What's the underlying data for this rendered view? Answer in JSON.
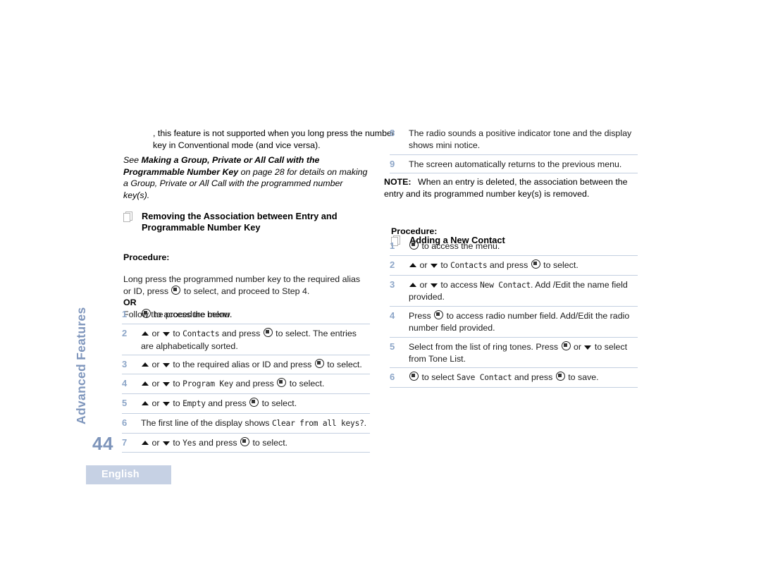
{
  "chapter": {
    "vertical_label": "Advanced Features",
    "page_number": "44",
    "language_tab": "English"
  },
  "left_column": {
    "intro_paragraph": ", this feature is not supported when you long press the number key in Conventional mode (and vice versa).",
    "see_note": {
      "lead": "See ",
      "bold_1": "Making a Group, Private or All Call with the Programmable Number Key",
      "tail": " on page 28 for details on making a Group, Private or All Call with the programmed number key(s)."
    },
    "section": {
      "icon": "pages-icon",
      "title": "Removing the Association between Entry and Programmable Number Key",
      "procedure_label": "Procedure:",
      "lead_in_1": "Long press the programmed number key to the required alias or ID, press ",
      "lead_in_2": " to select, and proceed to Step 4.",
      "or_label": "OR",
      "follow_text": "Follow the procedure below."
    },
    "steps": [
      {
        "num": "1",
        "parts": [
          {
            "t": "icon",
            "v": "menu-select-button-icon"
          },
          {
            "t": "text",
            "v": " to access the menu."
          }
        ]
      },
      {
        "num": "2",
        "parts": [
          {
            "t": "icon",
            "v": "triangle-up-icon"
          },
          {
            "t": "text",
            "v": " or "
          },
          {
            "t": "icon",
            "v": "triangle-down-icon"
          },
          {
            "t": "text",
            "v": " to "
          },
          {
            "t": "mono",
            "v": "Contacts"
          },
          {
            "t": "text",
            "v": " and press "
          },
          {
            "t": "icon",
            "v": "menu-select-button-icon"
          },
          {
            "t": "text",
            "v": " to select. The entries are alphabetically sorted."
          }
        ]
      },
      {
        "num": "3",
        "parts": [
          {
            "t": "icon",
            "v": "triangle-up-icon"
          },
          {
            "t": "text",
            "v": " or "
          },
          {
            "t": "icon",
            "v": "triangle-down-icon"
          },
          {
            "t": "text",
            "v": " to the required alias or ID and press "
          },
          {
            "t": "icon",
            "v": "menu-select-button-icon"
          },
          {
            "t": "text",
            "v": " to select."
          }
        ]
      },
      {
        "num": "4",
        "parts": [
          {
            "t": "icon",
            "v": "triangle-up-icon"
          },
          {
            "t": "text",
            "v": " or "
          },
          {
            "t": "icon",
            "v": "triangle-down-icon"
          },
          {
            "t": "text",
            "v": " to "
          },
          {
            "t": "mono",
            "v": "Program Key"
          },
          {
            "t": "text",
            "v": " and press "
          },
          {
            "t": "icon",
            "v": "menu-select-button-icon"
          },
          {
            "t": "text",
            "v": " to select."
          }
        ]
      },
      {
        "num": "5",
        "parts": [
          {
            "t": "icon",
            "v": "triangle-up-icon"
          },
          {
            "t": "text",
            "v": " or "
          },
          {
            "t": "icon",
            "v": "triangle-down-icon"
          },
          {
            "t": "text",
            "v": " to "
          },
          {
            "t": "mono",
            "v": "Empty"
          },
          {
            "t": "text",
            "v": " and press "
          },
          {
            "t": "icon",
            "v": "menu-select-button-icon"
          },
          {
            "t": "text",
            "v": " to select."
          }
        ]
      },
      {
        "num": "6",
        "parts": [
          {
            "t": "text",
            "v": "The first line of the display shows "
          },
          {
            "t": "mono",
            "v": "Clear from all keys?"
          },
          {
            "t": "text",
            "v": "."
          }
        ]
      },
      {
        "num": "7",
        "parts": [
          {
            "t": "icon",
            "v": "triangle-up-icon"
          },
          {
            "t": "text",
            "v": " or "
          },
          {
            "t": "icon",
            "v": "triangle-down-icon"
          },
          {
            "t": "text",
            "v": " to "
          },
          {
            "t": "mono",
            "v": "Yes"
          },
          {
            "t": "text",
            "v": " and press "
          },
          {
            "t": "icon",
            "v": "menu-select-button-icon"
          },
          {
            "t": "text",
            "v": " to select."
          }
        ]
      }
    ]
  },
  "right_column": {
    "steps_continued": [
      {
        "num": "8",
        "parts": [
          {
            "t": "text",
            "v": "The radio sounds a positive indicator tone and the display shows mini notice."
          }
        ]
      },
      {
        "num": "9",
        "parts": [
          {
            "t": "text",
            "v": "The screen automatically returns to the previous menu."
          }
        ]
      }
    ],
    "note": {
      "label": "NOTE:",
      "text": "When an entry is deleted, the association between the entry and its programmed number key(s) is removed."
    },
    "section": {
      "icon": "pages-icon",
      "title": "Adding a New Contact",
      "procedure_label": "Procedure:"
    },
    "steps": [
      {
        "num": "1",
        "parts": [
          {
            "t": "icon",
            "v": "menu-select-button-icon"
          },
          {
            "t": "text",
            "v": " to access the  menu."
          }
        ]
      },
      {
        "num": "2",
        "parts": [
          {
            "t": "icon",
            "v": "triangle-up-icon"
          },
          {
            "t": "text",
            "v": " or "
          },
          {
            "t": "icon",
            "v": "triangle-down-icon"
          },
          {
            "t": "text",
            "v": " to "
          },
          {
            "t": "mono",
            "v": "Contacts"
          },
          {
            "t": "text",
            "v": " and press "
          },
          {
            "t": "icon",
            "v": "menu-select-button-icon"
          },
          {
            "t": "text",
            "v": " to select."
          }
        ]
      },
      {
        "num": "3",
        "parts": [
          {
            "t": "icon",
            "v": "triangle-up-icon"
          },
          {
            "t": "text",
            "v": " or "
          },
          {
            "t": "icon",
            "v": "triangle-down-icon"
          },
          {
            "t": "text",
            "v": " to access "
          },
          {
            "t": "mono",
            "v": "New Contact"
          },
          {
            "t": "text",
            "v": ". Add /Edit the name field provided."
          }
        ]
      },
      {
        "num": "4",
        "parts": [
          {
            "t": "text",
            "v": "Press "
          },
          {
            "t": "icon",
            "v": "menu-select-button-icon"
          },
          {
            "t": "text",
            "v": " to access radio number field. Add/Edit the radio number field provided."
          }
        ]
      },
      {
        "num": "5",
        "parts": [
          {
            "t": "text",
            "v": "Select from the list of ring tones. Press "
          },
          {
            "t": "icon",
            "v": "menu-select-button-icon"
          },
          {
            "t": "text",
            "v": " or "
          },
          {
            "t": "icon",
            "v": "triangle-down-icon"
          },
          {
            "t": "text",
            "v": " to select from Tone List."
          }
        ]
      },
      {
        "num": "6",
        "parts": [
          {
            "t": "icon",
            "v": "menu-select-button-icon"
          },
          {
            "t": "text",
            "v": " to select "
          },
          {
            "t": "mono",
            "v": "Save Contact"
          },
          {
            "t": "text",
            "v": " and press "
          },
          {
            "t": "icon",
            "v": "menu-select-button-icon"
          },
          {
            "t": "text",
            "v": " to save."
          }
        ]
      }
    ]
  },
  "colors": {
    "step_number": "#8da6c8",
    "divider": "#c3cfe0",
    "chapter_tab_text": "#8097bd",
    "page_number": "#7d94ba",
    "language_tab_bg": "#c6d1e4",
    "language_tab_text": "#ffffff"
  }
}
